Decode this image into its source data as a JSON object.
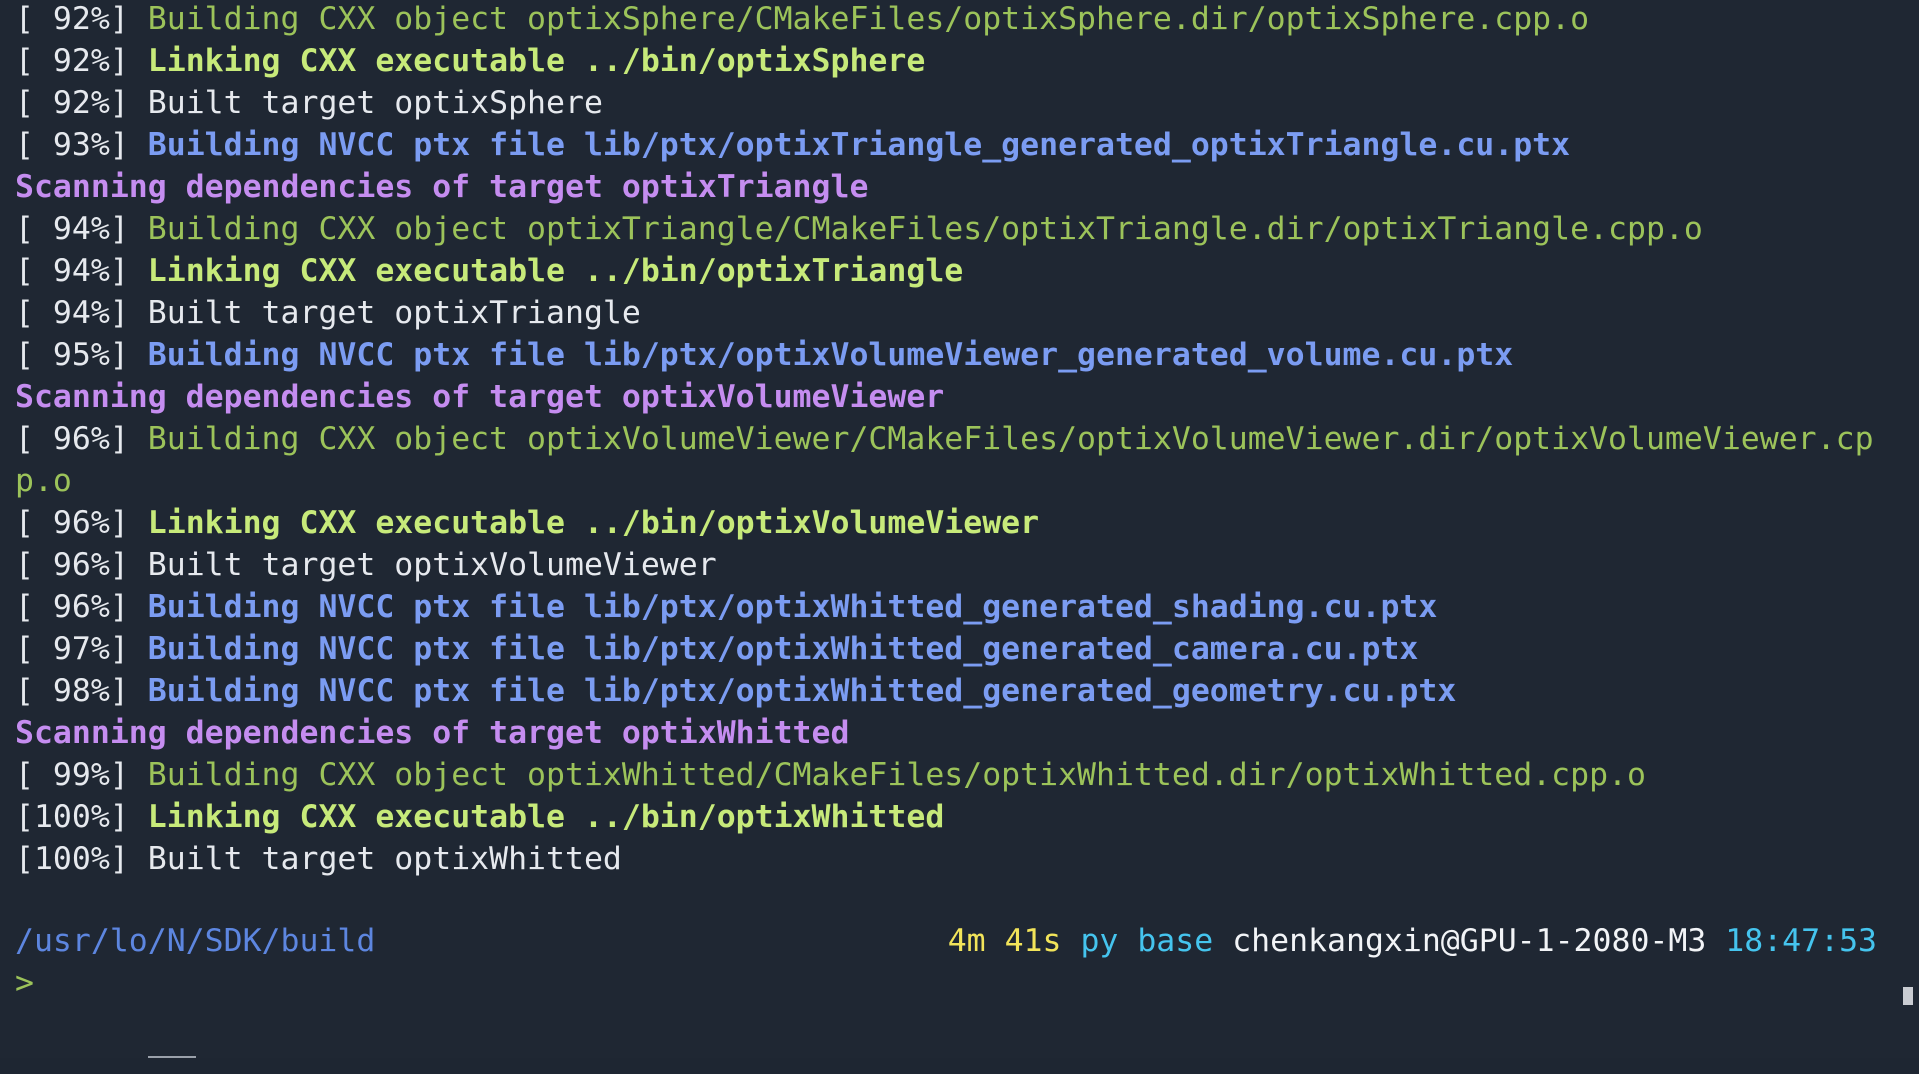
{
  "terminal": {
    "lines": [
      {
        "pct": "[ 92%]",
        "msg": "Building CXX object optixSphere/CMakeFiles/optixSphere.dir/optixSphere.cpp.o",
        "kind": "c-green"
      },
      {
        "pct": "[ 92%]",
        "msg": "Linking CXX executable ../bin/optixSphere",
        "kind": "c-greenb"
      },
      {
        "pct": "[ 92%]",
        "msg": "Built target optixSphere",
        "kind": "c-white"
      },
      {
        "pct": "[ 93%]",
        "msg": "Building NVCC ptx file lib/ptx/optixTriangle_generated_optixTriangle.cu.ptx",
        "kind": "c-blue"
      },
      {
        "pct": "",
        "msg": "Scanning dependencies of target optixTriangle",
        "kind": "c-purple"
      },
      {
        "pct": "[ 94%]",
        "msg": "Building CXX object optixTriangle/CMakeFiles/optixTriangle.dir/optixTriangle.cpp.o",
        "kind": "c-green"
      },
      {
        "pct": "[ 94%]",
        "msg": "Linking CXX executable ../bin/optixTriangle",
        "kind": "c-greenb"
      },
      {
        "pct": "[ 94%]",
        "msg": "Built target optixTriangle",
        "kind": "c-white"
      },
      {
        "pct": "[ 95%]",
        "msg": "Building NVCC ptx file lib/ptx/optixVolumeViewer_generated_volume.cu.ptx",
        "kind": "c-blue"
      },
      {
        "pct": "",
        "msg": "Scanning dependencies of target optixVolumeViewer",
        "kind": "c-purple"
      },
      {
        "pct": "[ 96%]",
        "msg": "Building CXX object optixVolumeViewer/CMakeFiles/optixVolumeViewer.dir/optixVolumeViewer.cp",
        "kind": "c-green"
      },
      {
        "pct": "",
        "msg": "p.o",
        "kind": "c-green"
      },
      {
        "pct": "[ 96%]",
        "msg": "Linking CXX executable ../bin/optixVolumeViewer",
        "kind": "c-greenb"
      },
      {
        "pct": "[ 96%]",
        "msg": "Built target optixVolumeViewer",
        "kind": "c-white"
      },
      {
        "pct": "[ 96%]",
        "msg": "Building NVCC ptx file lib/ptx/optixWhitted_generated_shading.cu.ptx",
        "kind": "c-blue"
      },
      {
        "pct": "[ 97%]",
        "msg": "Building NVCC ptx file lib/ptx/optixWhitted_generated_camera.cu.ptx",
        "kind": "c-blue"
      },
      {
        "pct": "[ 98%]",
        "msg": "Building NVCC ptx file lib/ptx/optixWhitted_generated_geometry.cu.ptx",
        "kind": "c-blue"
      },
      {
        "pct": "",
        "msg": "Scanning dependencies of target optixWhitted",
        "kind": "c-purple"
      },
      {
        "pct": "[ 99%]",
        "msg": "Building CXX object optixWhitted/CMakeFiles/optixWhitted.dir/optixWhitted.cpp.o",
        "kind": "c-green"
      },
      {
        "pct": "[100%]",
        "msg": "Linking CXX executable ../bin/optixWhitted",
        "kind": "c-greenb"
      },
      {
        "pct": "[100%]",
        "msg": "Built target optixWhitted",
        "kind": "c-white"
      }
    ],
    "prompt": {
      "cwd": "/usr/lo/N/SDK/build",
      "duration": "4m 41s",
      "env_label": "py base",
      "user_host": "chenkangxin@GPU-1-2080-M3",
      "time": "18:47:53",
      "caret": ">"
    }
  }
}
